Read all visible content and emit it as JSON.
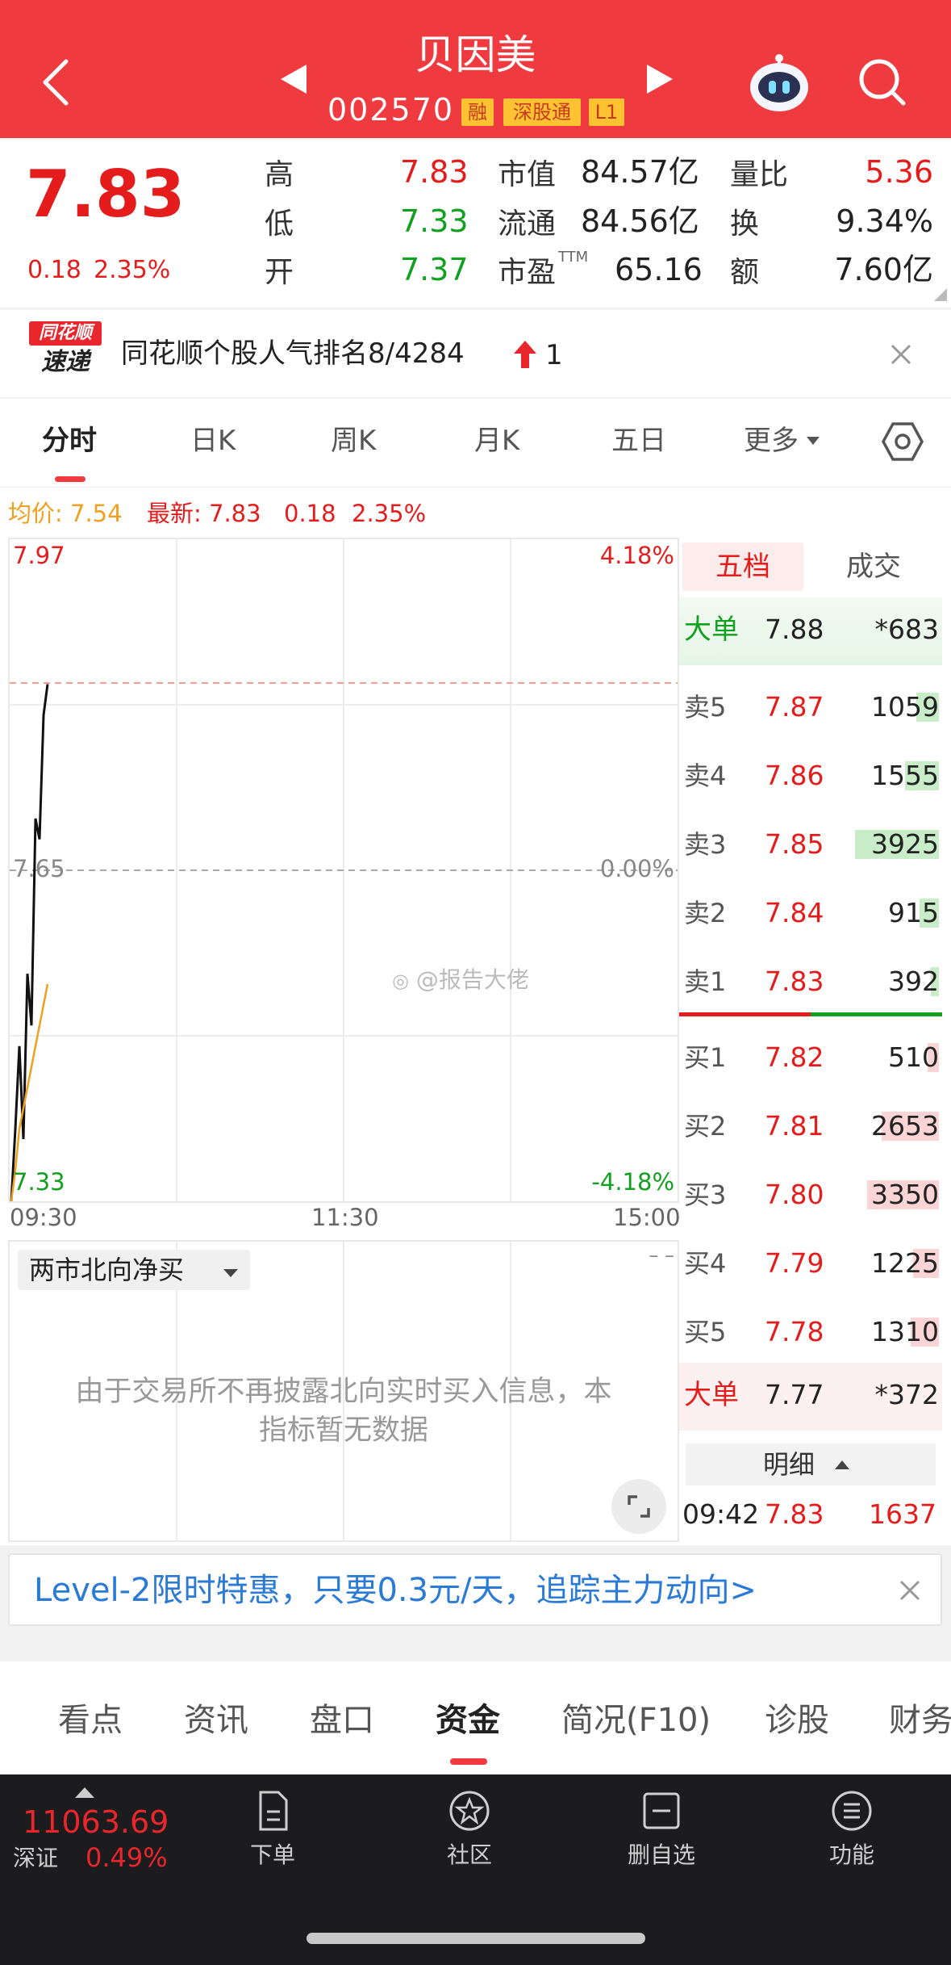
{
  "header": {
    "title": "贝因美",
    "code": "002570",
    "tags": [
      "融",
      "深股通",
      "L1"
    ]
  },
  "quote": {
    "price": "7.83",
    "change": "0.18",
    "change_pct": "2.35%",
    "high_label": "高",
    "high": "7.83",
    "low_label": "低",
    "low": "7.33",
    "open_label": "开",
    "open": "7.37",
    "mcap_label": "市值",
    "mcap": "84.57亿",
    "float_label": "流通",
    "float": "84.56亿",
    "pe_label": "市盈",
    "pe_sup": "TTM",
    "pe": "65.16",
    "volratio_label": "量比",
    "volratio": "5.36",
    "turnover_label": "换",
    "turnover": "9.34%",
    "amount_label": "额",
    "amount": "7.60亿"
  },
  "rank": {
    "logo_top": "同花顺",
    "logo_bottom": "速递",
    "text": "同花顺个股人气排名8/4284",
    "delta": "1"
  },
  "tabs": [
    "分时",
    "日K",
    "周K",
    "月K",
    "五日",
    "更多"
  ],
  "chart": {
    "avg_label": "均价: 7.54",
    "last_label": "最新: 7.83",
    "chg": "0.18",
    "chg_pct": "2.35%",
    "y_top": "7.97",
    "y_mid": "7.65",
    "y_bottom": "7.33",
    "pct_top": "4.18%",
    "pct_mid": "0.00%",
    "pct_bottom": "-4.18%",
    "t_start": "09:30",
    "t_mid": "11:30",
    "t_end": "15:00",
    "watermark": "@报告大佬"
  },
  "chart_data": {
    "type": "line",
    "ylim": [
      7.33,
      7.97
    ],
    "series": [
      {
        "values": [
          7.33,
          7.4,
          7.48,
          7.39,
          7.55,
          7.5,
          7.7,
          7.68,
          7.8,
          7.83
        ]
      },
      {
        "values": [
          7.33,
          7.36,
          7.4,
          7.42,
          7.44,
          7.46,
          7.48,
          7.5,
          7.52,
          7.54
        ]
      }
    ]
  },
  "north": {
    "selector": "两市北向净买",
    "msg1": "由于交易所不再披露北向实时买入信息，本",
    "msg2": "指标暂无数据",
    "dash": "– –"
  },
  "orderbook": {
    "tab_active": "五档",
    "tab_other": "成交",
    "big_top": {
      "label": "大单",
      "price": "7.88",
      "vol": "*683"
    },
    "asks": [
      {
        "label": "卖5",
        "price": "7.87",
        "vol": "1059",
        "fill": 0.27
      },
      {
        "label": "卖4",
        "price": "7.86",
        "vol": "1555",
        "fill": 0.4
      },
      {
        "label": "卖3",
        "price": "7.85",
        "vol": "3925",
        "fill": 1.0
      },
      {
        "label": "卖2",
        "price": "7.84",
        "vol": "915",
        "fill": 0.23
      },
      {
        "label": "卖1",
        "price": "7.83",
        "vol": "392",
        "fill": 0.1
      }
    ],
    "bids": [
      {
        "label": "买1",
        "price": "7.82",
        "vol": "510",
        "fill": 0.13
      },
      {
        "label": "买2",
        "price": "7.81",
        "vol": "2653",
        "fill": 0.68
      },
      {
        "label": "买3",
        "price": "7.80",
        "vol": "3350",
        "fill": 0.86
      },
      {
        "label": "买4",
        "price": "7.79",
        "vol": "1225",
        "fill": 0.31
      },
      {
        "label": "买5",
        "price": "7.78",
        "vol": "1310",
        "fill": 0.34
      }
    ],
    "big_bottom": {
      "label": "大单",
      "price": "7.77",
      "vol": "*372"
    },
    "detail_label": "明细",
    "detail_time": "09:42",
    "detail_price": "7.83",
    "detail_vol": "1637"
  },
  "promo": "Level-2限时特惠，只要0.3元/天，追踪主力动向>",
  "bottom_tabs": [
    "看点",
    "资讯",
    "盘口",
    "资金",
    "简况(F10)",
    "诊股",
    "财务"
  ],
  "dock": {
    "index_value": "11063.69",
    "index_name": "深证",
    "index_pct": "0.49%",
    "items": [
      "下单",
      "社区",
      "删自选",
      "功能"
    ]
  }
}
